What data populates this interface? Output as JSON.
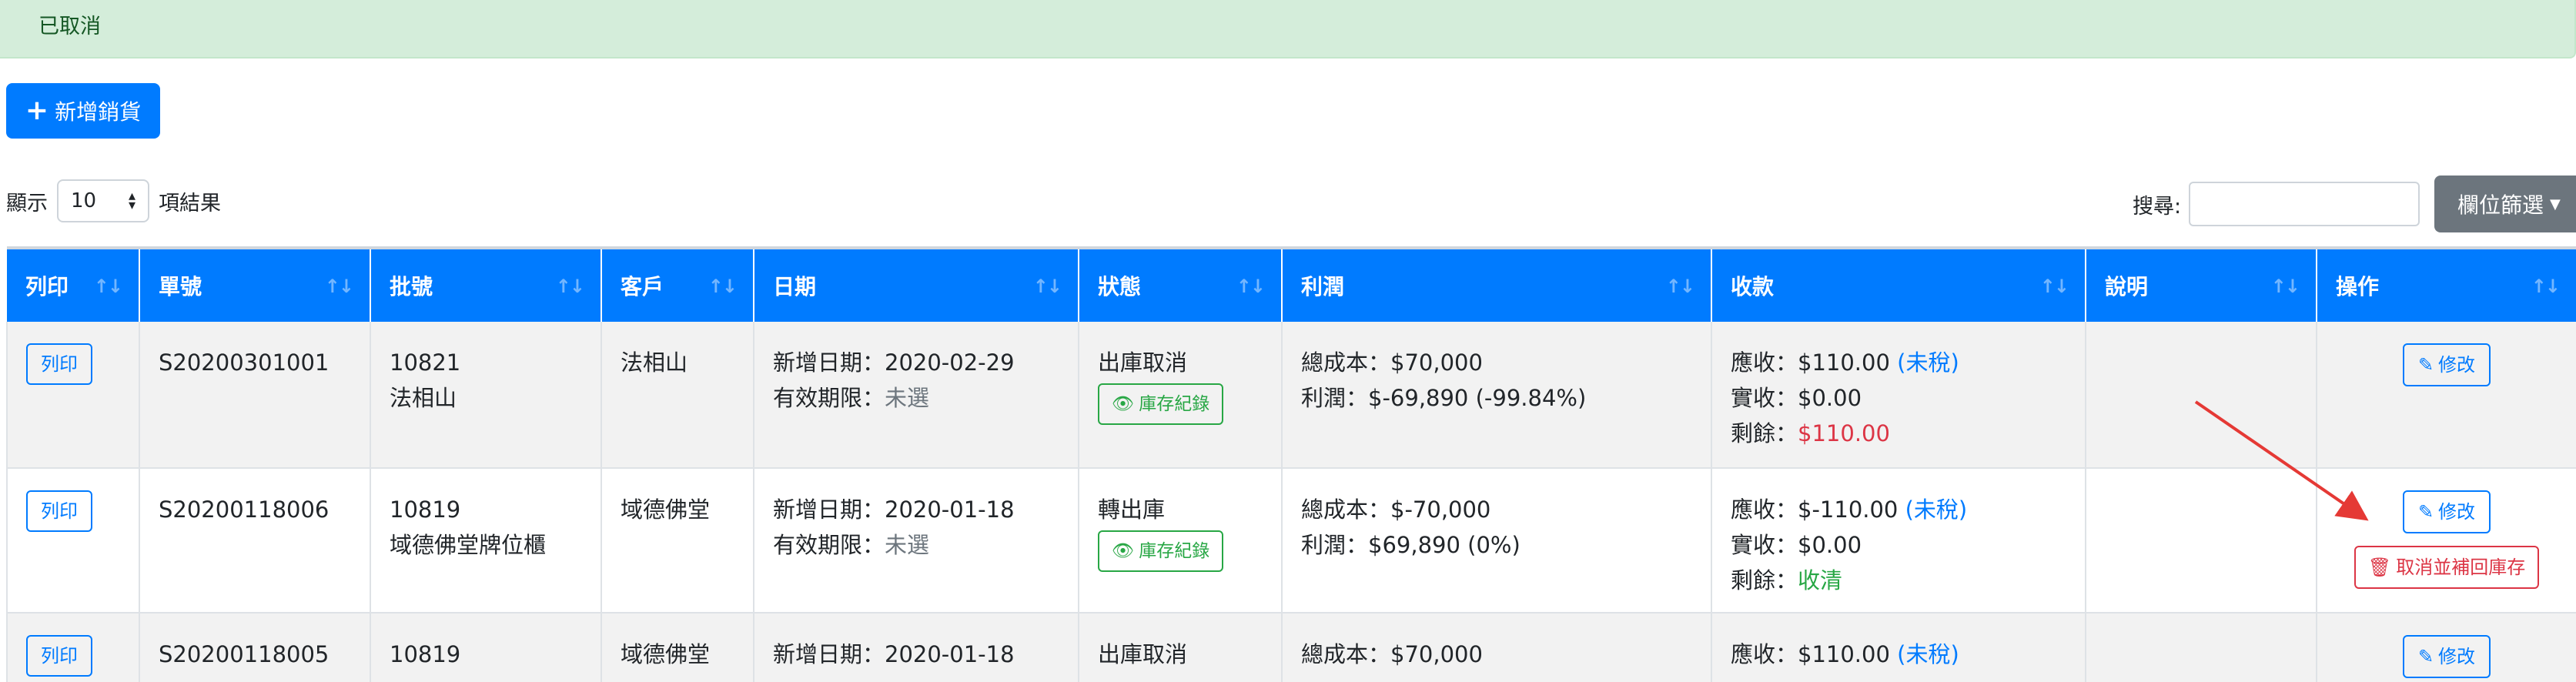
{
  "alert": {
    "text": "已取消"
  },
  "toolbar": {
    "add_label": "新增銷貨",
    "filter_label": "欄位篩選"
  },
  "length_menu": {
    "prefix": "顯示",
    "value": "10",
    "suffix": "項結果"
  },
  "search": {
    "label": "搜尋:",
    "value": ""
  },
  "columns": [
    "列印",
    "單號",
    "批號",
    "客戶",
    "日期",
    "狀態",
    "利潤",
    "收款",
    "說明",
    "操作"
  ],
  "rows": [
    {
      "print_label": "列印",
      "order_no": "S20200301001",
      "batch_no": "10821",
      "batch_name": "法相山",
      "customer": "法相山",
      "date_label": "新增日期：2020-02-29",
      "expiry_prefix": "有效期限：",
      "expiry_value": "未選",
      "status": "出庫取消",
      "stock_label": "庫存紀錄",
      "cost": "總成本：$70,000",
      "profit": "利潤：$-69,890 (-99.84%)",
      "receivable_prefix": "應收：$110.00 ",
      "receivable_tax": "(未稅)",
      "received": "實收：$0.00",
      "balance_prefix": "剩餘：",
      "balance_value": "$110.00",
      "note": "",
      "edit_label": "修改"
    },
    {
      "print_label": "列印",
      "order_no": "S20200118006",
      "batch_no": "10819",
      "batch_name": "域德佛堂牌位櫃",
      "customer": "域德佛堂",
      "date_label": "新增日期：2020-01-18",
      "expiry_prefix": "有效期限：",
      "expiry_value": "未選",
      "status": "轉出庫",
      "stock_label": "庫存紀錄",
      "cost": "總成本：$-70,000",
      "profit": "利潤：$69,890 (0%)",
      "receivable_prefix": "應收：$-110.00 ",
      "receivable_tax": "(未稅)",
      "received": "實收：$0.00",
      "balance_prefix": "剩餘：",
      "balance_value": "收清",
      "note": "",
      "edit_label": "修改",
      "cancel_label": "取消並補回庫存"
    },
    {
      "print_label": "列印",
      "order_no": "S20200118005",
      "batch_no": "10819",
      "customer": "域德佛堂",
      "date_label": "新增日期：2020-01-18",
      "status": "出庫取消",
      "cost": "總成本：$70,000",
      "receivable_prefix": "應收：$110.00 ",
      "receivable_tax": "(未稅)",
      "note": "",
      "edit_label": "修改"
    }
  ],
  "colors": {
    "primary": "#007bff",
    "success": "#28a745",
    "danger": "#dc3545",
    "alert_bg": "#d4edda"
  },
  "icons": [
    "plus-icon",
    "sort-icon",
    "eye-icon",
    "pencil-icon",
    "trash-icon",
    "caret-down-icon",
    "annotation-arrow"
  ]
}
